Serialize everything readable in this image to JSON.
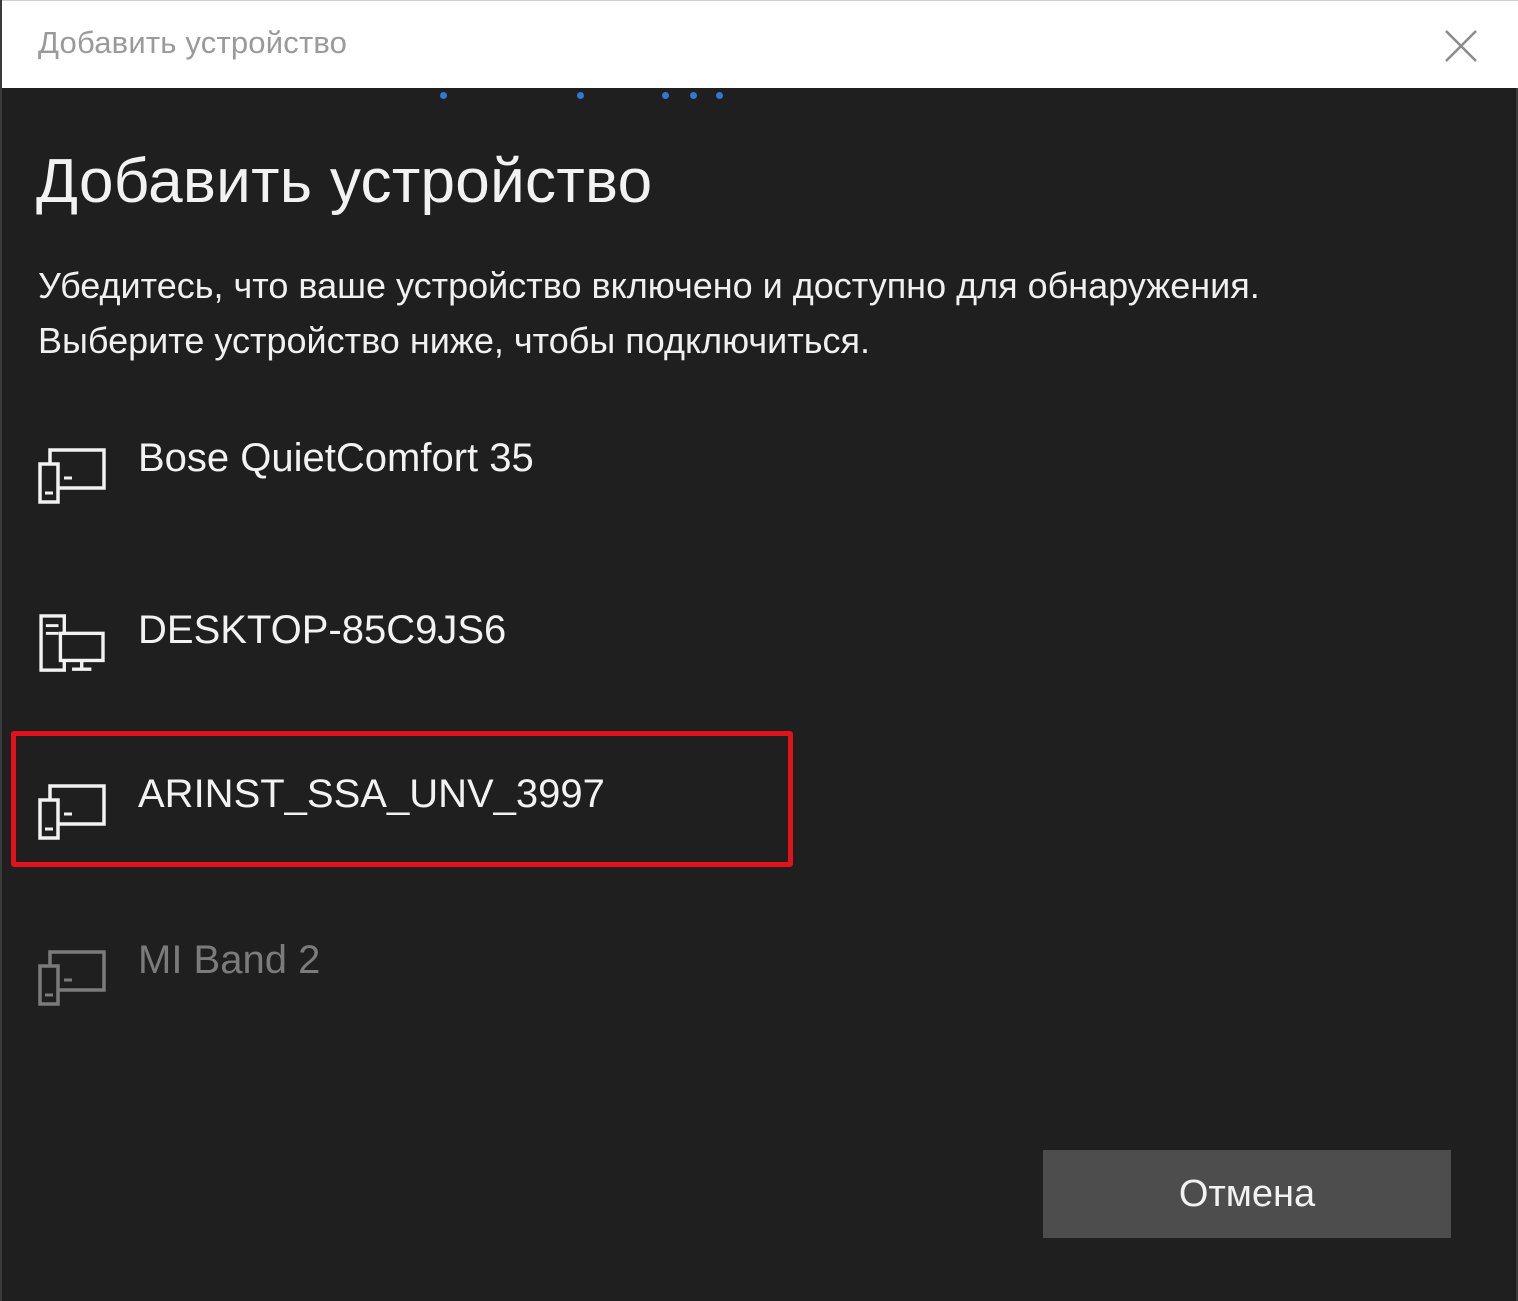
{
  "window": {
    "title": "Добавить устройство"
  },
  "main": {
    "heading": "Добавить устройство",
    "description_line1": "Убедитесь, что ваше устройство включено и доступно для обнаружения.",
    "description_line2": "Выберите устройство ниже, чтобы подключиться."
  },
  "devices": [
    {
      "name": "Bose QuietComfort 35",
      "icon": "generic-device-icon",
      "dimmed": false
    },
    {
      "name": "DESKTOP-85C9JS6",
      "icon": "computer-device-icon",
      "dimmed": false
    },
    {
      "name": "ARINST_SSA_UNV_3997",
      "icon": "generic-device-icon",
      "dimmed": false,
      "highlighted": true
    },
    {
      "name": "MI Band 2",
      "icon": "generic-device-icon",
      "dimmed": true
    }
  ],
  "footer": {
    "cancel_label": "Отмена"
  },
  "colors": {
    "background": "#1f1f1f",
    "text": "#f2f2f2",
    "dimmed_text": "#7b7b7b",
    "highlight": "#e3111a",
    "progress": "#2a7ad6",
    "button": "#4d4d4d"
  }
}
